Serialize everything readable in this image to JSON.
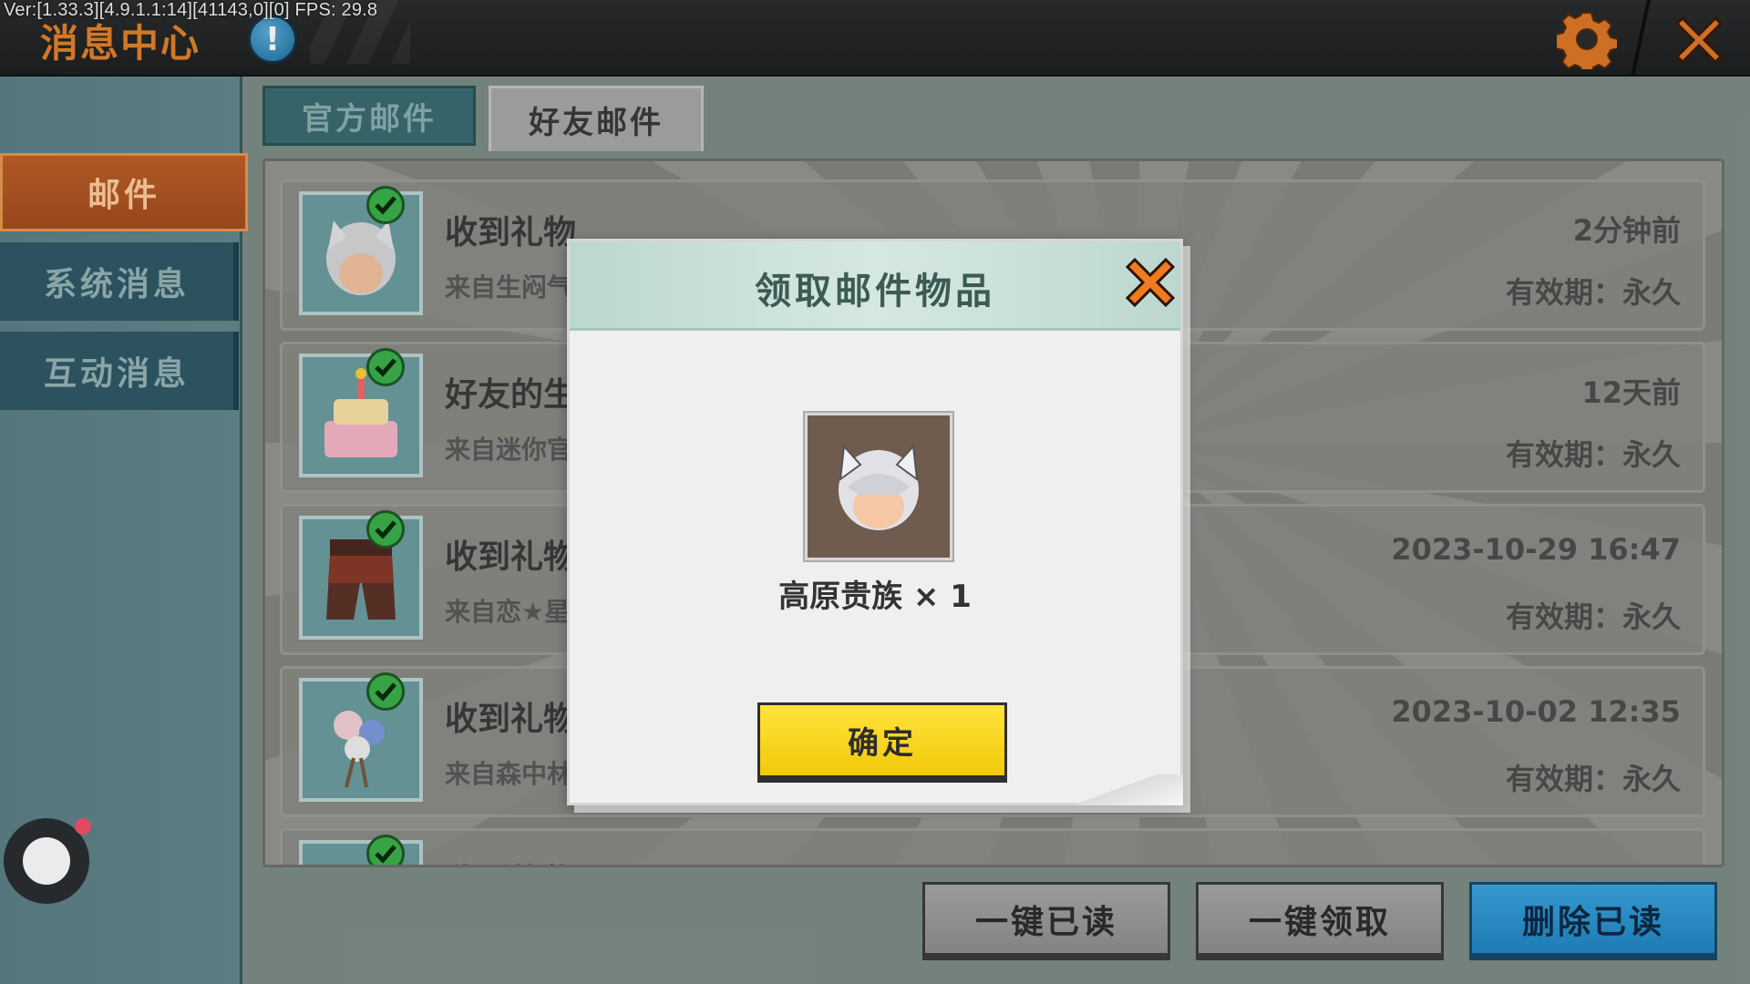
{
  "debug": {
    "version_text": "Ver:[1.33.3][4.9.1.1:14][41143,0][0] FPS: 29.8"
  },
  "header": {
    "title": "消息中心",
    "info_label": "!"
  },
  "sidebar": {
    "items": [
      {
        "label": "邮件",
        "active": true
      },
      {
        "label": "系统消息",
        "active": false
      },
      {
        "label": "互动消息",
        "active": false
      }
    ]
  },
  "tabs": [
    {
      "label": "官方邮件",
      "active": false
    },
    {
      "label": "好友邮件",
      "active": true
    }
  ],
  "mails": [
    {
      "title": "收到礼物",
      "sender": "来自生闷气",
      "time": "2分钟前",
      "expiry": "有效期：永久",
      "icon": "silver-hair-icon"
    },
    {
      "title": "好友的生",
      "sender": "来自迷你官",
      "time": "12天前",
      "expiry": "有效期：永久",
      "icon": "birthday-cake-icon"
    },
    {
      "title": "收到礼物",
      "sender": "来自恋★星",
      "time": "2023-10-29 16:47",
      "expiry": "有效期：永久",
      "icon": "pants-icon"
    },
    {
      "title": "收到礼物",
      "sender": "来自森中林",
      "time": "2023-10-02 12:35",
      "expiry": "有效期：永久",
      "icon": "flower-bouquet-icon"
    },
    {
      "title": "收到礼物",
      "sender": "",
      "time": "",
      "expiry": "",
      "icon": "gift-icon"
    }
  ],
  "bottom_buttons": {
    "mark_all_read": "一键已读",
    "claim_all": "一键领取",
    "delete_read": "删除已读"
  },
  "modal": {
    "title": "领取邮件物品",
    "item_name": "高原贵族 × 1",
    "confirm_label": "确定"
  },
  "colors": {
    "accent_orange": "#e3832c",
    "confirm_yellow": "#ffe33b",
    "delete_blue": "#2a95d3",
    "check_green": "#3bb24a"
  }
}
